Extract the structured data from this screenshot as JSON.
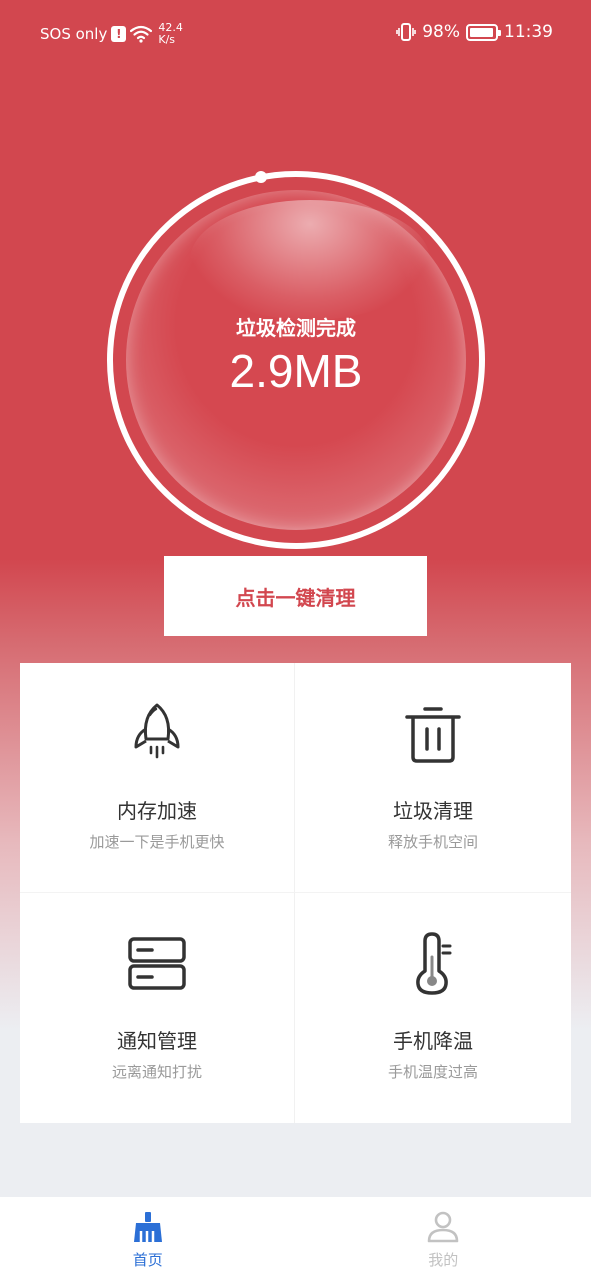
{
  "status_bar": {
    "carrier": "SOS only",
    "net_speed_value": "42.4",
    "net_speed_unit": "K/s",
    "battery": "98%",
    "time": "11:39"
  },
  "gauge": {
    "caption": "垃圾检测完成",
    "size": "2.9MB"
  },
  "clean_button": "点击一键清理",
  "features": [
    {
      "title": "内存加速",
      "subtitle": "加速一下是手机更快",
      "icon": "rocket-icon"
    },
    {
      "title": "垃圾清理",
      "subtitle": "释放手机空间",
      "icon": "trash-icon"
    },
    {
      "title": "通知管理",
      "subtitle": "远离通知打扰",
      "icon": "notification-stack-icon"
    },
    {
      "title": "手机降温",
      "subtitle": "手机温度过高",
      "icon": "thermometer-icon"
    }
  ],
  "bottom_nav": [
    {
      "label": "首页",
      "active": true,
      "icon": "broom-icon"
    },
    {
      "label": "我的",
      "active": false,
      "icon": "user-icon"
    }
  ],
  "colors": {
    "primary": "#d2474f",
    "nav_active": "#2b6fd6",
    "nav_inactive": "#c2c2c2"
  }
}
